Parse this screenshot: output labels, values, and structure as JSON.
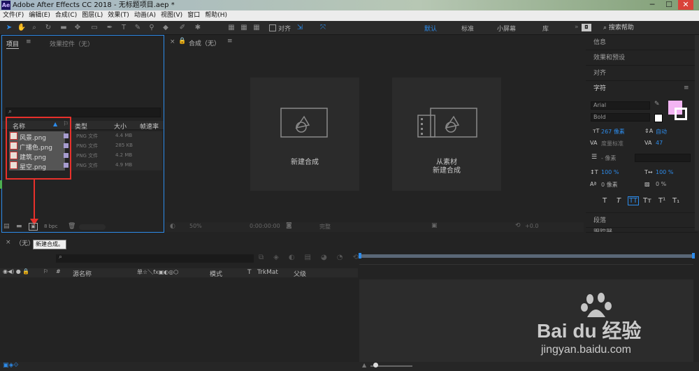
{
  "window": {
    "title": "Adobe After Effects CC 2018 - 无标题项目.aep *",
    "logo": "Ae",
    "controls": [
      "─",
      "☐",
      "✕"
    ]
  },
  "menu": [
    "文件(F)",
    "编辑(E)",
    "合成(C)",
    "图层(L)",
    "效果(T)",
    "动画(A)",
    "视图(V)",
    "窗口",
    "帮助(H)"
  ],
  "toolbar": {
    "align_label": "对齐",
    "workspaces": [
      "默认",
      "标准",
      "小屏幕",
      "库"
    ],
    "active_workspace": "默认",
    "search_placeholder": "搜索帮助"
  },
  "project": {
    "tab": "项目",
    "effects_tab": "效果控件（无）",
    "columns": [
      "名称",
      "类型",
      "大小",
      "帧速率"
    ],
    "files": [
      {
        "name": "风景.png",
        "type": "PNG 文件",
        "size": "4.4 MB"
      },
      {
        "name": "广播色.png",
        "type": "PNG 文件",
        "size": "285 KB"
      },
      {
        "name": "建筑.png",
        "type": "PNG 文件",
        "size": "4.2 MB"
      },
      {
        "name": "星空.png",
        "type": "PNG 文件",
        "size": "4.9 MB"
      }
    ],
    "bpc": "8 bpc"
  },
  "comp": {
    "tab": "合成（无）",
    "new_comp": "新建合成",
    "from_footage_line1": "从素材",
    "from_footage_line2": "新建合成",
    "zoom": "50%",
    "time": "0:00:00:00",
    "quality": "完整",
    "exposure": "+0.0"
  },
  "right": {
    "info": "信息",
    "effects_presets": "效果和预设",
    "align": "对齐",
    "character": "字符",
    "font": "Arial",
    "style": "Bold",
    "font_size": "267 像素",
    "leading": "自动",
    "kerning": "度量标准",
    "tracking": "47",
    "stroke_width": "- 像素",
    "vscale": "100 %",
    "hscale": "100 %",
    "baseline": "0 像素",
    "tsume": "0 %",
    "paragraph": "段落",
    "tracker": "跟踪器",
    "text_styles": [
      "T",
      "T",
      "TT",
      "Tт",
      "T¹",
      "T₁"
    ],
    "swatch": "#f3b5f3"
  },
  "timeline": {
    "tab": "（无）",
    "columns": [
      "源名称",
      "模式",
      "T",
      "TrkMat",
      "父级"
    ],
    "switch_icons": "单☆＼fx▣◐◎⬡"
  },
  "tooltip": "新建合成。",
  "watermark": {
    "brand": "Bai du 经验",
    "url": "jingyan.baidu.com"
  }
}
